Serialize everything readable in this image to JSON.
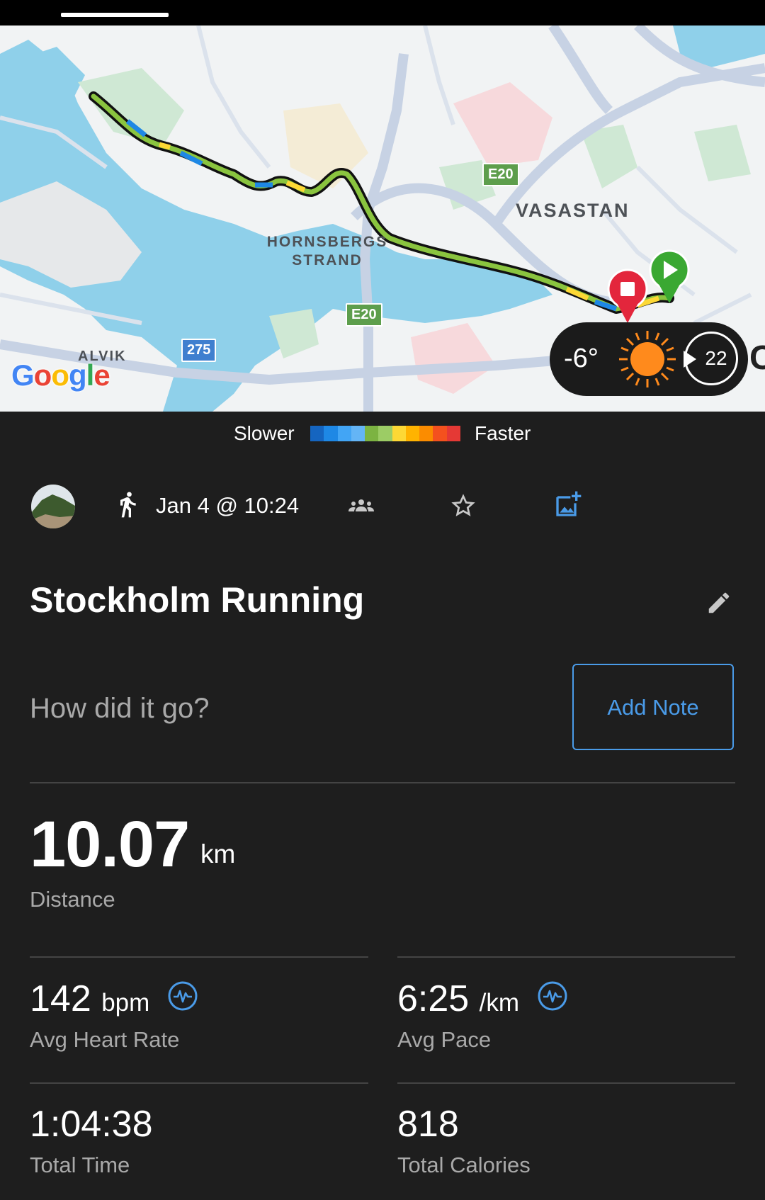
{
  "map": {
    "labels": {
      "vasastan": "VASASTAN",
      "hornsbergs": "HORNSBERGS",
      "strand": "STRAND",
      "alvik": "ALVIK"
    },
    "shields": {
      "e20_top": "E20",
      "e20_bottom": "E20",
      "r275": "275"
    },
    "brand": "Google"
  },
  "weather": {
    "temperature": "-6°",
    "wind_speed": "22",
    "icon": "sun-icon"
  },
  "pace_legend": {
    "slower_label": "Slower",
    "faster_label": "Faster",
    "colors": [
      "#1565c0",
      "#1e88e5",
      "#42a5f5",
      "#64b5f6",
      "#7cb342",
      "#9ccc65",
      "#fdd835",
      "#ffb300",
      "#fb8c00",
      "#f4511e",
      "#e53935"
    ]
  },
  "activity": {
    "date": "Jan 4 @ 10:24",
    "type_icon": "running-icon",
    "title": "Stockholm Running",
    "note_prompt": "How did it go?",
    "add_note_label": "Add Note"
  },
  "stats": {
    "distance": {
      "value": "10.07",
      "unit": "km",
      "label": "Distance"
    },
    "avg_heart_rate": {
      "value": "142",
      "unit": "bpm",
      "label": "Avg Heart Rate"
    },
    "avg_pace": {
      "value": "6:25",
      "unit": "/km",
      "label": "Avg Pace"
    },
    "total_time": {
      "value": "1:04:38",
      "label": "Total Time"
    },
    "total_calories": {
      "value": "818",
      "label": "Total Calories"
    }
  },
  "colors": {
    "accent": "#4a9be8",
    "background": "#1e1e1e",
    "secondary_text": "#a9a9a9"
  }
}
